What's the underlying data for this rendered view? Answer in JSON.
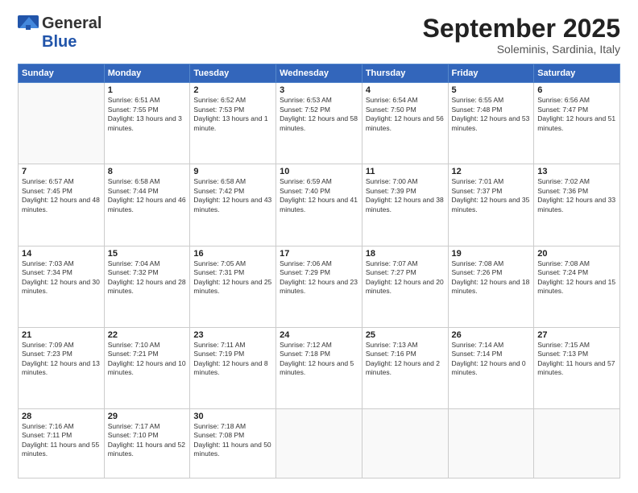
{
  "header": {
    "logo_general": "General",
    "logo_blue": "Blue",
    "month_title": "September 2025",
    "subtitle": "Soleminis, Sardinia, Italy"
  },
  "days_of_week": [
    "Sunday",
    "Monday",
    "Tuesday",
    "Wednesday",
    "Thursday",
    "Friday",
    "Saturday"
  ],
  "weeks": [
    [
      {
        "day": "",
        "empty": true
      },
      {
        "day": "1",
        "sunrise": "6:51 AM",
        "sunset": "7:55 PM",
        "daylight": "13 hours and 3 minutes."
      },
      {
        "day": "2",
        "sunrise": "6:52 AM",
        "sunset": "7:53 PM",
        "daylight": "13 hours and 1 minute."
      },
      {
        "day": "3",
        "sunrise": "6:53 AM",
        "sunset": "7:52 PM",
        "daylight": "12 hours and 58 minutes."
      },
      {
        "day": "4",
        "sunrise": "6:54 AM",
        "sunset": "7:50 PM",
        "daylight": "12 hours and 56 minutes."
      },
      {
        "day": "5",
        "sunrise": "6:55 AM",
        "sunset": "7:48 PM",
        "daylight": "12 hours and 53 minutes."
      },
      {
        "day": "6",
        "sunrise": "6:56 AM",
        "sunset": "7:47 PM",
        "daylight": "12 hours and 51 minutes."
      }
    ],
    [
      {
        "day": "7",
        "sunrise": "6:57 AM",
        "sunset": "7:45 PM",
        "daylight": "12 hours and 48 minutes."
      },
      {
        "day": "8",
        "sunrise": "6:58 AM",
        "sunset": "7:44 PM",
        "daylight": "12 hours and 46 minutes."
      },
      {
        "day": "9",
        "sunrise": "6:58 AM",
        "sunset": "7:42 PM",
        "daylight": "12 hours and 43 minutes."
      },
      {
        "day": "10",
        "sunrise": "6:59 AM",
        "sunset": "7:40 PM",
        "daylight": "12 hours and 41 minutes."
      },
      {
        "day": "11",
        "sunrise": "7:00 AM",
        "sunset": "7:39 PM",
        "daylight": "12 hours and 38 minutes."
      },
      {
        "day": "12",
        "sunrise": "7:01 AM",
        "sunset": "7:37 PM",
        "daylight": "12 hours and 35 minutes."
      },
      {
        "day": "13",
        "sunrise": "7:02 AM",
        "sunset": "7:36 PM",
        "daylight": "12 hours and 33 minutes."
      }
    ],
    [
      {
        "day": "14",
        "sunrise": "7:03 AM",
        "sunset": "7:34 PM",
        "daylight": "12 hours and 30 minutes."
      },
      {
        "day": "15",
        "sunrise": "7:04 AM",
        "sunset": "7:32 PM",
        "daylight": "12 hours and 28 minutes."
      },
      {
        "day": "16",
        "sunrise": "7:05 AM",
        "sunset": "7:31 PM",
        "daylight": "12 hours and 25 minutes."
      },
      {
        "day": "17",
        "sunrise": "7:06 AM",
        "sunset": "7:29 PM",
        "daylight": "12 hours and 23 minutes."
      },
      {
        "day": "18",
        "sunrise": "7:07 AM",
        "sunset": "7:27 PM",
        "daylight": "12 hours and 20 minutes."
      },
      {
        "day": "19",
        "sunrise": "7:08 AM",
        "sunset": "7:26 PM",
        "daylight": "12 hours and 18 minutes."
      },
      {
        "day": "20",
        "sunrise": "7:08 AM",
        "sunset": "7:24 PM",
        "daylight": "12 hours and 15 minutes."
      }
    ],
    [
      {
        "day": "21",
        "sunrise": "7:09 AM",
        "sunset": "7:23 PM",
        "daylight": "12 hours and 13 minutes."
      },
      {
        "day": "22",
        "sunrise": "7:10 AM",
        "sunset": "7:21 PM",
        "daylight": "12 hours and 10 minutes."
      },
      {
        "day": "23",
        "sunrise": "7:11 AM",
        "sunset": "7:19 PM",
        "daylight": "12 hours and 8 minutes."
      },
      {
        "day": "24",
        "sunrise": "7:12 AM",
        "sunset": "7:18 PM",
        "daylight": "12 hours and 5 minutes."
      },
      {
        "day": "25",
        "sunrise": "7:13 AM",
        "sunset": "7:16 PM",
        "daylight": "12 hours and 2 minutes."
      },
      {
        "day": "26",
        "sunrise": "7:14 AM",
        "sunset": "7:14 PM",
        "daylight": "12 hours and 0 minutes."
      },
      {
        "day": "27",
        "sunrise": "7:15 AM",
        "sunset": "7:13 PM",
        "daylight": "11 hours and 57 minutes."
      }
    ],
    [
      {
        "day": "28",
        "sunrise": "7:16 AM",
        "sunset": "7:11 PM",
        "daylight": "11 hours and 55 minutes."
      },
      {
        "day": "29",
        "sunrise": "7:17 AM",
        "sunset": "7:10 PM",
        "daylight": "11 hours and 52 minutes."
      },
      {
        "day": "30",
        "sunrise": "7:18 AM",
        "sunset": "7:08 PM",
        "daylight": "11 hours and 50 minutes."
      },
      {
        "day": "",
        "empty": true
      },
      {
        "day": "",
        "empty": true
      },
      {
        "day": "",
        "empty": true
      },
      {
        "day": "",
        "empty": true
      }
    ]
  ]
}
